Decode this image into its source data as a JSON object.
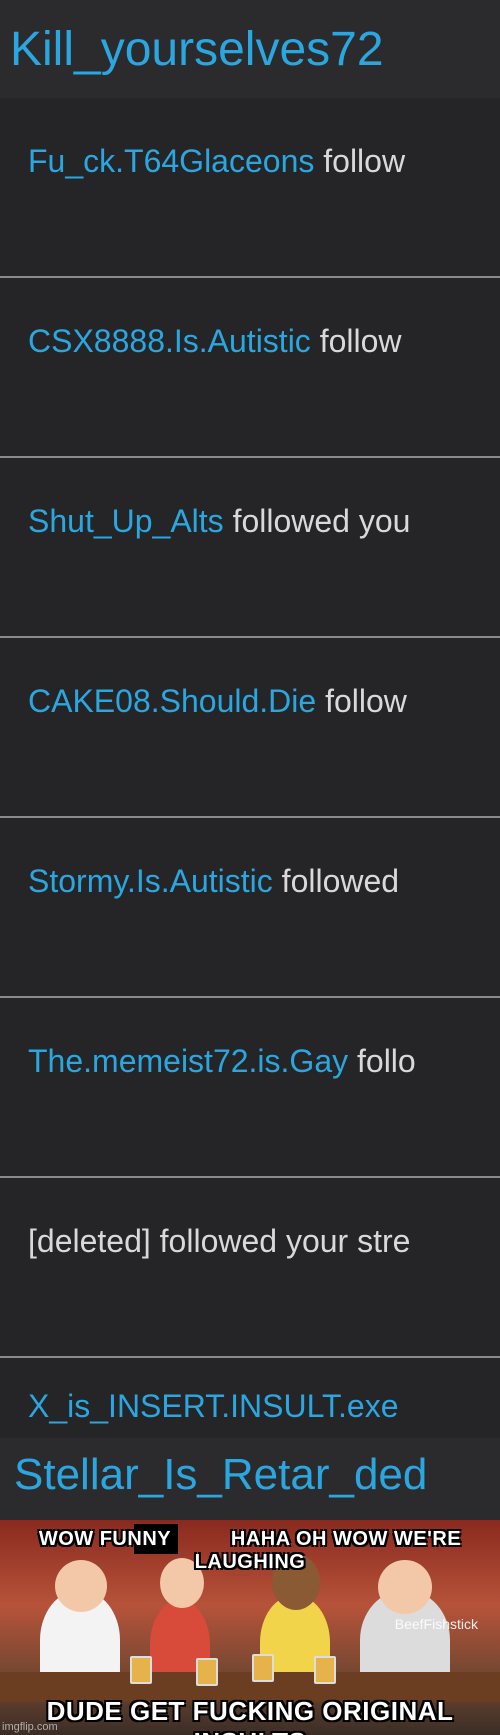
{
  "header": {
    "title": "Kill_yourselves72"
  },
  "notifications": [
    {
      "user": "Fu_ck.T64Glaceons",
      "action": "follow"
    },
    {
      "user": "CSX8888.Is.Autistic",
      "action": "follow"
    },
    {
      "user": "Shut_Up_Alts",
      "action": "followed you"
    },
    {
      "user": "CAKE08.Should.Die",
      "action": "follow"
    },
    {
      "user": "Stormy.Is.Autistic",
      "action": "followed"
    },
    {
      "user": "The.memeist72.is.Gay",
      "action": "follo"
    },
    {
      "user": "",
      "action": "[deleted] followed your stre"
    },
    {
      "user": "X_is_INSERT.INSULT.exe",
      "action": ""
    }
  ],
  "footer": {
    "title": "Stellar_Is_Retar_ded"
  },
  "meme": {
    "top_left": "WOW FUNNY",
    "top_right": "HAHA OH WOW WE'RE LAUGHING",
    "bottom": "DUDE GET FUCKING ORIGINAL INSULTS",
    "watermark": "BeefFishstick",
    "site": "imgflip.com"
  },
  "colors": {
    "username": "#2aa7e0",
    "text": "#d9d9d9",
    "background": "#252527"
  }
}
